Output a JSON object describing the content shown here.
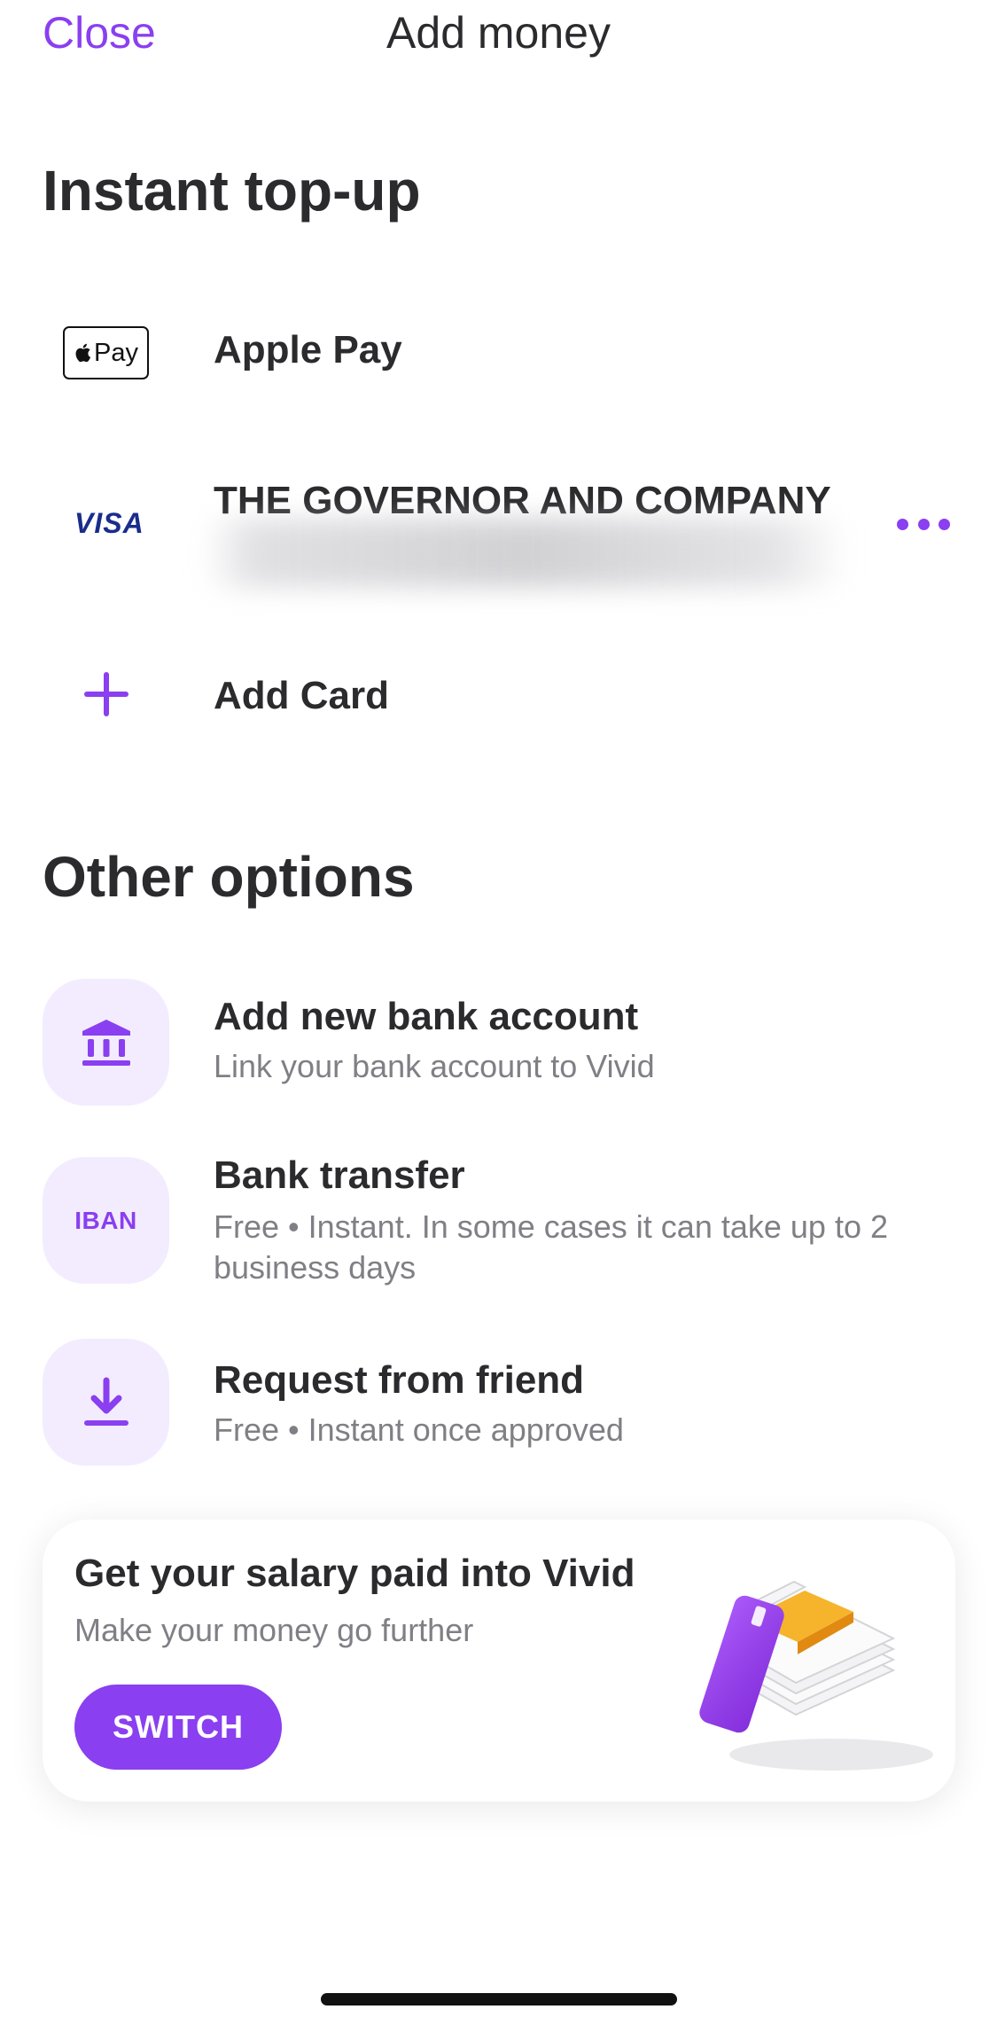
{
  "nav": {
    "close_label": "Close",
    "title": "Add money"
  },
  "instant_topup": {
    "title": "Instant top-up",
    "apple_pay": {
      "badge_text": "Pay",
      "label": "Apple Pay",
      "icon": "apple-pay-icon"
    },
    "card": {
      "brand": "VISA",
      "name": "THE GOVERNOR AND COMPANY",
      "icon": "more-dots-icon"
    },
    "add_card": {
      "label": "Add Card",
      "icon": "plus-icon"
    }
  },
  "other_options": {
    "title": "Other options",
    "items": [
      {
        "title": "Add new bank account",
        "subtitle": "Link your bank account to Vivid",
        "icon": "bank-icon"
      },
      {
        "title": "Bank transfer",
        "subtitle": "Free • Instant. In some cases it can take up to 2 business days",
        "icon_text": "IBAN"
      },
      {
        "title": "Request from friend",
        "subtitle": "Free • Instant once approved",
        "icon": "download-icon"
      }
    ]
  },
  "promo": {
    "title": "Get your salary paid into Vivid",
    "subtitle": "Make your money go further",
    "button_label": "SWITCH"
  },
  "colors": {
    "accent": "#8a3ff0",
    "icon_bg": "#f3ecfe",
    "text": "#2b2b2e",
    "subtext": "#7f7f85",
    "visa": "#1a2c8c"
  }
}
